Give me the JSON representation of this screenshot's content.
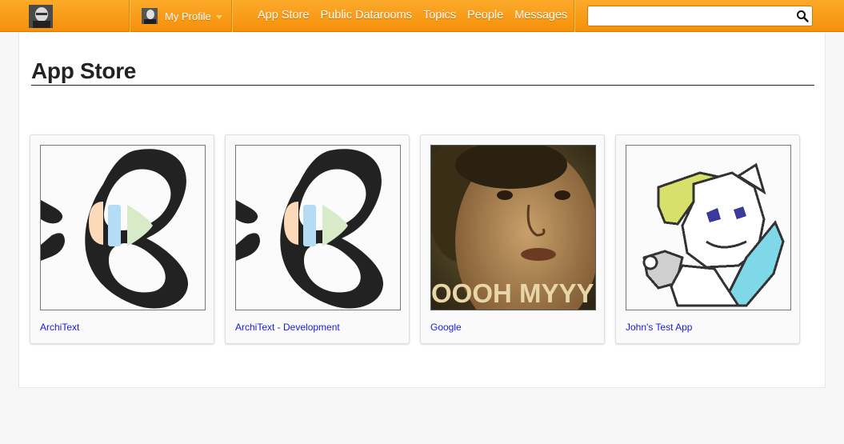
{
  "nav": {
    "profile_label": "My Profile",
    "links": [
      "App Store",
      "Public Datarooms",
      "Topics",
      "People",
      "Messages"
    ],
    "search": {
      "value": "",
      "placeholder": ""
    }
  },
  "page": {
    "title": "App Store"
  },
  "apps": [
    {
      "name": "ArchiText",
      "icon": "architext-logo-icon"
    },
    {
      "name": "ArchiText - Development",
      "icon": "architext-logo-icon"
    },
    {
      "name": "Google",
      "icon": "gif-thumbnail",
      "caption": "OOOH MYYY"
    },
    {
      "name": "John's Test App",
      "icon": "pixel-cat-thumbnail"
    }
  ],
  "colors": {
    "nav_orange": "#f7990f",
    "link_blue": "#1a1ae6",
    "title": "#222222"
  }
}
